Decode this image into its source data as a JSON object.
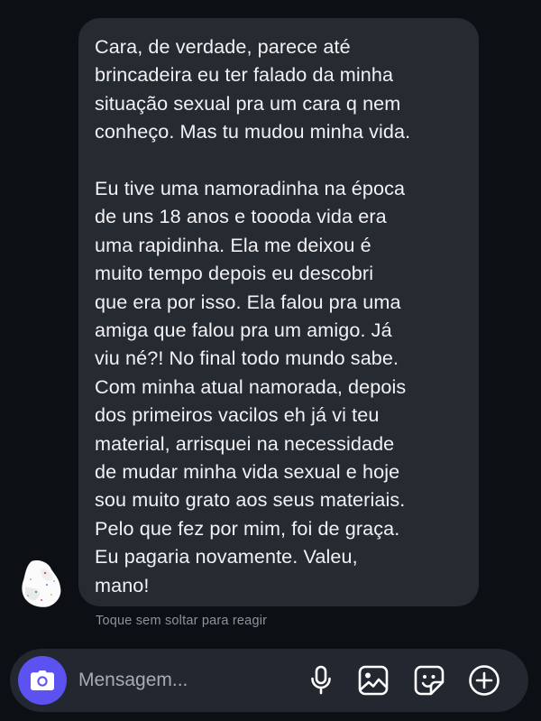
{
  "message": {
    "paragraphs": [
      "Cara, de verdade, parece até\nbrincadeira eu ter falado da minha\nsituação sexual pra um cara q nem\nconheço. Mas tu mudou minha vida.",
      "Eu tive uma namoradinha na época\nde uns 18 anos e toooda vida era\numa rapidinha. Ela me deixou é\nmuito tempo depois eu descobri\nque era por isso. Ela falou pra uma\namiga que falou pra um amigo. Já\nviu né?! No final todo mundo sabe.\nCom minha atual namorada, depois\ndos primeiros vacilos eh já vi teu\nmaterial, arrisquei na necessidade\nde mudar minha vida sexual e hoje\nsou muito grato aos seus materiais.\nPelo que fez por mim, foi de graça.\nEu pagaria novamente. Valeu,\nmano!"
    ]
  },
  "reaction_hint": "Toque sem soltar para reagir",
  "composer": {
    "placeholder": "Mensagem...",
    "icons": [
      "camera-icon",
      "microphone-icon",
      "gallery-icon",
      "sticker-icon",
      "add-icon"
    ]
  },
  "colors": {
    "background": "#0c0f14",
    "bubble": "#262a31",
    "composer": "#232830",
    "accent": "#5b52f1",
    "hint_text": "#8e939b"
  }
}
